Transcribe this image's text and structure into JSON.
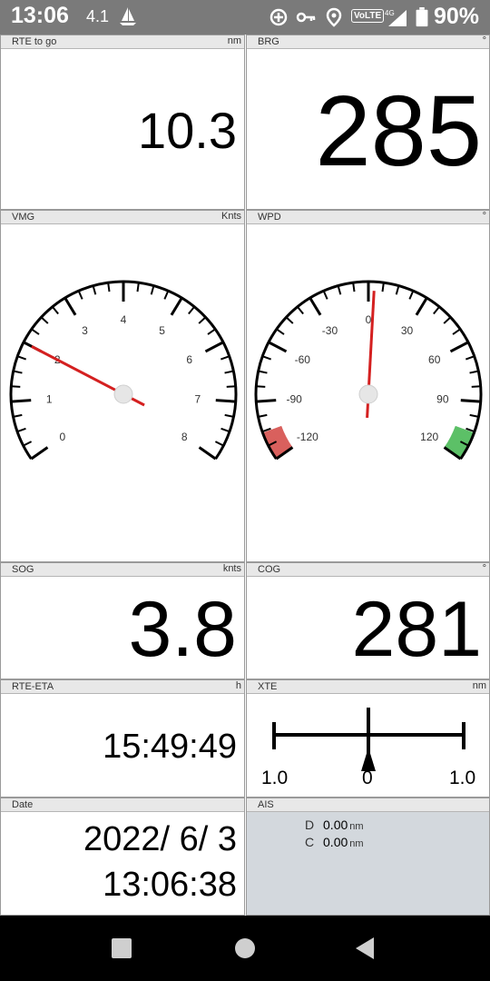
{
  "status_bar": {
    "time": "13:06",
    "speed": "4.1",
    "battery": "90%",
    "volte": "VoLTE",
    "network": "4G",
    "icons": [
      "sailboat-icon",
      "data-saver-icon",
      "vpn-key-icon",
      "location-icon",
      "volte-icon",
      "signal-icon",
      "battery-icon"
    ]
  },
  "panels": {
    "rte_to_go": {
      "title": "RTE to go",
      "unit": "nm",
      "value": "10.3"
    },
    "brg": {
      "title": "BRG",
      "unit": "°",
      "value": "285"
    },
    "vmg": {
      "title": "VMG",
      "unit": "Knts",
      "ticks": [
        "0",
        "1",
        "2",
        "3",
        "4",
        "5",
        "6",
        "7",
        "8"
      ],
      "needle_value": 2.0
    },
    "wpd": {
      "title": "WPD",
      "unit": "°",
      "ticks": [
        "-120",
        "-90",
        "-60",
        "-30",
        "0",
        "30",
        "60",
        "90",
        "120"
      ],
      "needle_value": 3
    },
    "sog": {
      "title": "SOG",
      "unit": "knts",
      "value": "3.8"
    },
    "cog": {
      "title": "COG",
      "unit": "°",
      "value": "281"
    },
    "rte_eta": {
      "title": "RTE-ETA",
      "unit": "h",
      "value": "15:49:49"
    },
    "xte": {
      "title": "XTE",
      "unit": "nm",
      "left_label": "1.0",
      "center_label": "0",
      "right_label": "1.0"
    },
    "date": {
      "title": "Date",
      "date": "2022/ 6/ 3",
      "time": "13:06:38"
    },
    "ais": {
      "title": "AIS",
      "d_label": "D",
      "d_value": "0.00",
      "d_unit": "nm",
      "c_label": "C",
      "c_value": "0.00",
      "c_unit": "nm"
    }
  },
  "nav_bar": {
    "buttons": [
      "recents-button",
      "home-button",
      "back-button"
    ]
  }
}
